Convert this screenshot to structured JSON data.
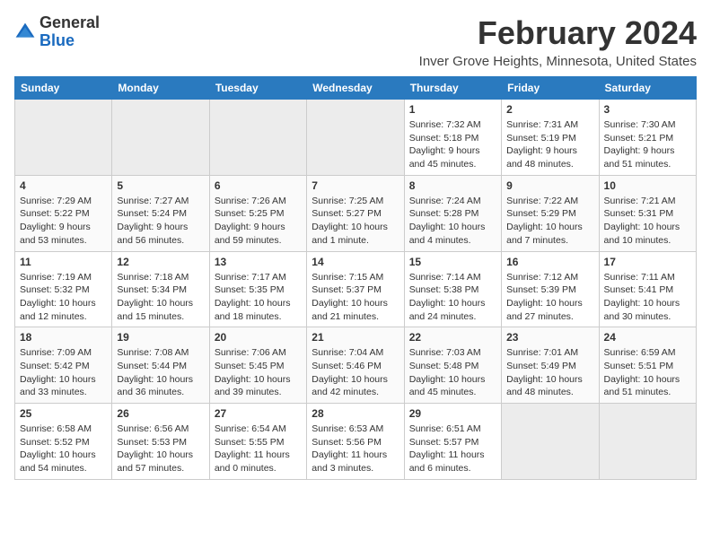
{
  "header": {
    "logo_general": "General",
    "logo_blue": "Blue",
    "month": "February 2024",
    "location": "Inver Grove Heights, Minnesota, United States"
  },
  "weekdays": [
    "Sunday",
    "Monday",
    "Tuesday",
    "Wednesday",
    "Thursday",
    "Friday",
    "Saturday"
  ],
  "weeks": [
    [
      {
        "day": "",
        "empty": true
      },
      {
        "day": "",
        "empty": true
      },
      {
        "day": "",
        "empty": true
      },
      {
        "day": "",
        "empty": true
      },
      {
        "day": "1",
        "sunrise": "7:32 AM",
        "sunset": "5:18 PM",
        "daylight": "9 hours and 45 minutes."
      },
      {
        "day": "2",
        "sunrise": "7:31 AM",
        "sunset": "5:19 PM",
        "daylight": "9 hours and 48 minutes."
      },
      {
        "day": "3",
        "sunrise": "7:30 AM",
        "sunset": "5:21 PM",
        "daylight": "9 hours and 51 minutes."
      }
    ],
    [
      {
        "day": "4",
        "sunrise": "7:29 AM",
        "sunset": "5:22 PM",
        "daylight": "9 hours and 53 minutes."
      },
      {
        "day": "5",
        "sunrise": "7:27 AM",
        "sunset": "5:24 PM",
        "daylight": "9 hours and 56 minutes."
      },
      {
        "day": "6",
        "sunrise": "7:26 AM",
        "sunset": "5:25 PM",
        "daylight": "9 hours and 59 minutes."
      },
      {
        "day": "7",
        "sunrise": "7:25 AM",
        "sunset": "5:27 PM",
        "daylight": "10 hours and 1 minute."
      },
      {
        "day": "8",
        "sunrise": "7:24 AM",
        "sunset": "5:28 PM",
        "daylight": "10 hours and 4 minutes."
      },
      {
        "day": "9",
        "sunrise": "7:22 AM",
        "sunset": "5:29 PM",
        "daylight": "10 hours and 7 minutes."
      },
      {
        "day": "10",
        "sunrise": "7:21 AM",
        "sunset": "5:31 PM",
        "daylight": "10 hours and 10 minutes."
      }
    ],
    [
      {
        "day": "11",
        "sunrise": "7:19 AM",
        "sunset": "5:32 PM",
        "daylight": "10 hours and 12 minutes."
      },
      {
        "day": "12",
        "sunrise": "7:18 AM",
        "sunset": "5:34 PM",
        "daylight": "10 hours and 15 minutes."
      },
      {
        "day": "13",
        "sunrise": "7:17 AM",
        "sunset": "5:35 PM",
        "daylight": "10 hours and 18 minutes."
      },
      {
        "day": "14",
        "sunrise": "7:15 AM",
        "sunset": "5:37 PM",
        "daylight": "10 hours and 21 minutes."
      },
      {
        "day": "15",
        "sunrise": "7:14 AM",
        "sunset": "5:38 PM",
        "daylight": "10 hours and 24 minutes."
      },
      {
        "day": "16",
        "sunrise": "7:12 AM",
        "sunset": "5:39 PM",
        "daylight": "10 hours and 27 minutes."
      },
      {
        "day": "17",
        "sunrise": "7:11 AM",
        "sunset": "5:41 PM",
        "daylight": "10 hours and 30 minutes."
      }
    ],
    [
      {
        "day": "18",
        "sunrise": "7:09 AM",
        "sunset": "5:42 PM",
        "daylight": "10 hours and 33 minutes."
      },
      {
        "day": "19",
        "sunrise": "7:08 AM",
        "sunset": "5:44 PM",
        "daylight": "10 hours and 36 minutes."
      },
      {
        "day": "20",
        "sunrise": "7:06 AM",
        "sunset": "5:45 PM",
        "daylight": "10 hours and 39 minutes."
      },
      {
        "day": "21",
        "sunrise": "7:04 AM",
        "sunset": "5:46 PM",
        "daylight": "10 hours and 42 minutes."
      },
      {
        "day": "22",
        "sunrise": "7:03 AM",
        "sunset": "5:48 PM",
        "daylight": "10 hours and 45 minutes."
      },
      {
        "day": "23",
        "sunrise": "7:01 AM",
        "sunset": "5:49 PM",
        "daylight": "10 hours and 48 minutes."
      },
      {
        "day": "24",
        "sunrise": "6:59 AM",
        "sunset": "5:51 PM",
        "daylight": "10 hours and 51 minutes."
      }
    ],
    [
      {
        "day": "25",
        "sunrise": "6:58 AM",
        "sunset": "5:52 PM",
        "daylight": "10 hours and 54 minutes."
      },
      {
        "day": "26",
        "sunrise": "6:56 AM",
        "sunset": "5:53 PM",
        "daylight": "10 hours and 57 minutes."
      },
      {
        "day": "27",
        "sunrise": "6:54 AM",
        "sunset": "5:55 PM",
        "daylight": "11 hours and 0 minutes."
      },
      {
        "day": "28",
        "sunrise": "6:53 AM",
        "sunset": "5:56 PM",
        "daylight": "11 hours and 3 minutes."
      },
      {
        "day": "29",
        "sunrise": "6:51 AM",
        "sunset": "5:57 PM",
        "daylight": "11 hours and 6 minutes."
      },
      {
        "day": "",
        "empty": true
      },
      {
        "day": "",
        "empty": true
      }
    ]
  ]
}
